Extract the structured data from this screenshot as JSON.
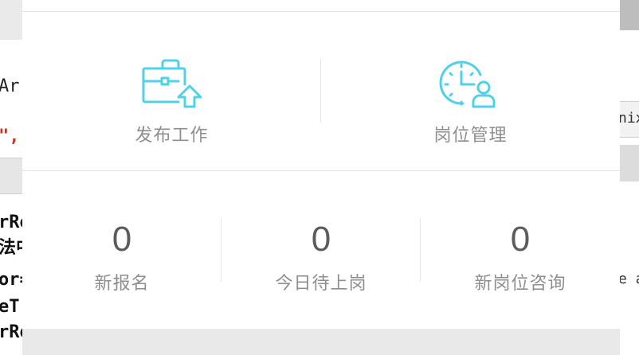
{
  "background": {
    "left_code": [
      "Arr",
      "\",",
      "rRo",
      "法中",
      "or=",
      "eT",
      "rRo"
    ],
    "right_snippets": [
      "nix",
      "e a"
    ]
  },
  "card": {
    "actions": [
      {
        "label": "发布工作",
        "icon": "briefcase-upload-icon"
      },
      {
        "label": "岗位管理",
        "icon": "clock-person-icon"
      }
    ],
    "stats": [
      {
        "value": "0",
        "label": "新报名"
      },
      {
        "value": "0",
        "label": "今日待上岗"
      },
      {
        "value": "0",
        "label": "新岗位咨询"
      }
    ],
    "colors": {
      "icon": "#4fd1e8",
      "label": "#8e8e8e",
      "number": "#5c5c5c"
    }
  }
}
